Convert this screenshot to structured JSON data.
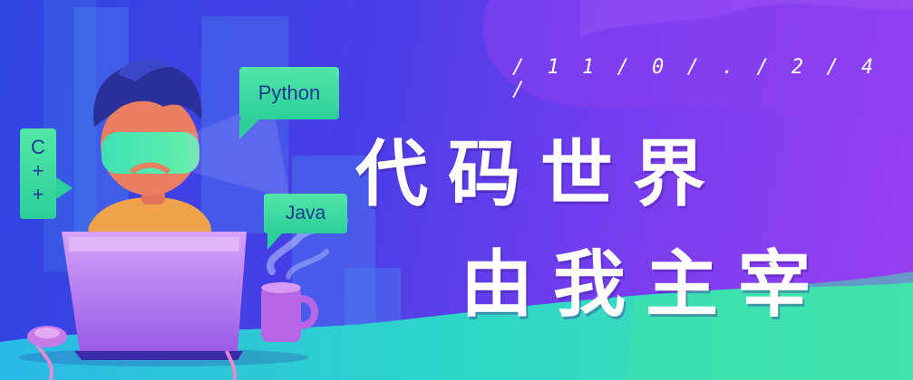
{
  "banner": {
    "date": "/ 1 1 / 0 / . / 2 / 4 /",
    "headline_line1": "代码世界",
    "headline_line2": "由我主宰"
  },
  "bubbles": {
    "python": "Python",
    "java": "Java",
    "cpp_line1": "C",
    "cpp_line2": "+",
    "cpp_line3": "+"
  },
  "colors": {
    "background_left": "#2f45e0",
    "background_right": "#9b3ff2",
    "bubble_green": "#2ccf9a",
    "ground_teal": "#2fd6c8",
    "headline_text": "#ffffff"
  }
}
